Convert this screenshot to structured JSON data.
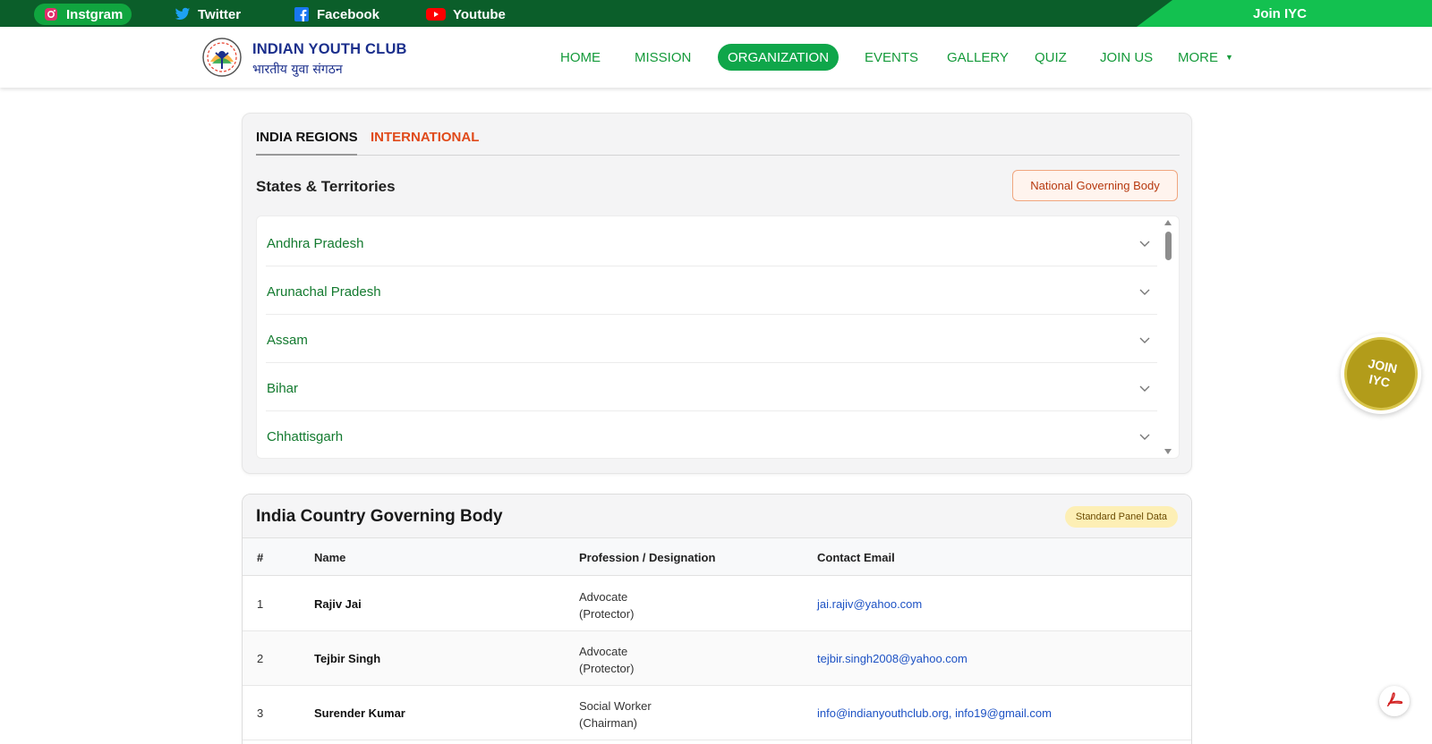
{
  "social": [
    {
      "label": "Instgram",
      "icon": "instagram-icon"
    },
    {
      "label": "Twitter",
      "icon": "twitter-icon"
    },
    {
      "label": "Facebook",
      "icon": "facebook-icon"
    },
    {
      "label": "Youtube",
      "icon": "youtube-icon"
    }
  ],
  "topbar": {
    "join_label": "Join IYC"
  },
  "brand": {
    "title": "INDIAN YOUTH CLUB",
    "subtitle": "भारतीय युवा संगठन"
  },
  "nav": [
    {
      "label": "HOME"
    },
    {
      "label": "MISSION"
    },
    {
      "label": "ORGANIZATION",
      "active": true
    },
    {
      "label": "EVENTS"
    },
    {
      "label": "GALLERY"
    },
    {
      "label": "QUIZ"
    },
    {
      "label": "JOIN US"
    },
    {
      "label": "MORE"
    }
  ],
  "regions": {
    "tabs": [
      {
        "label": "INDIA REGIONS",
        "active": true
      },
      {
        "label": "INTERNATIONAL"
      }
    ],
    "section_title": "States & Territories",
    "governing_button": "National Governing Body",
    "states": [
      "Andhra Pradesh",
      "Arunachal Pradesh",
      "Assam",
      "Bihar",
      "Chhattisgarh"
    ]
  },
  "governing": {
    "title": "India Country Governing Body",
    "badge": "Standard Panel Data",
    "columns": [
      "#",
      "Name",
      "Profession / Designation",
      "Contact Email"
    ],
    "rows": [
      {
        "num": "1",
        "name": "Rajiv Jai",
        "profession": "Advocate",
        "designation": "(Protector)",
        "email": "jai.rajiv@yahoo.com"
      },
      {
        "num": "2",
        "name": "Tejbir Singh",
        "profession": "Advocate",
        "designation": "(Protector)",
        "email": "tejbir.singh2008@yahoo.com"
      },
      {
        "num": "3",
        "name": "Surender Kumar",
        "profession": "Social Worker",
        "designation": "(Chairman)",
        "email": "info@indianyouthclub.org, info19@gmail.com"
      }
    ]
  },
  "join_float": {
    "line1": "JOIN",
    "line2": "IYC"
  },
  "colors": {
    "primary_green": "#0fa64a",
    "dark_green": "#0b5e2a",
    "brand_blue": "#1b2f8c",
    "accent_orange": "#e04a1a",
    "link_blue": "#1d52c4"
  }
}
